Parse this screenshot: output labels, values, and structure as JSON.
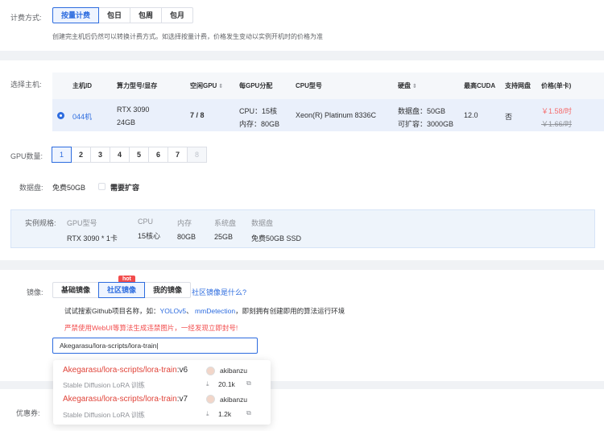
{
  "billing": {
    "label": "计费方式:",
    "options": [
      "按量计费",
      "包日",
      "包周",
      "包月"
    ],
    "hint": "创建完主机后仍然可以转换计费方式。如选择按量计费，价格发生变动以实例开机时的价格为准"
  },
  "host": {
    "label": "选择主机:",
    "headers": [
      "主机ID",
      "算力型号/显存",
      "空闲GPU",
      "每GPU分配",
      "CPU型号",
      "硬盘",
      "最高CUDA",
      "支持网盘",
      "价格(单卡)"
    ],
    "row": {
      "id": "044机",
      "gpu_model": "RTX 3090",
      "vram": "24GB",
      "free_gpu": "7 / 8",
      "cpu_alloc": "CPU：15核",
      "mem_alloc": "内存：80GB",
      "cpu_model": "Xeon(R) Platinum 8336C",
      "disk": "数据盘：50GB",
      "disk_ext": "可扩容：3000GB",
      "cuda": "12.0",
      "netdisk": "否",
      "price": "￥1.58/时",
      "old_price": "￥1.66/时"
    }
  },
  "gpu_count": {
    "label": "GPU数量:",
    "options": [
      "1",
      "2",
      "3",
      "4",
      "5",
      "6",
      "7",
      "8"
    ]
  },
  "data_disk": {
    "label": "数据盘:",
    "free": "免费50GB",
    "expand": "需要扩容"
  },
  "spec": {
    "label": "实例规格:",
    "cols": [
      {
        "h": "GPU型号",
        "v": "RTX 3090 * 1卡"
      },
      {
        "h": "CPU",
        "v": "15核心"
      },
      {
        "h": "内存",
        "v": "80GB"
      },
      {
        "h": "系统盘",
        "v": "25GB"
      },
      {
        "h": "数据盘",
        "v": "免费50GB SSD"
      }
    ]
  },
  "image": {
    "label": "镜像:",
    "tabs": [
      "基础镜像",
      "社区镜像",
      "我的镜像"
    ],
    "hot": "hot",
    "what_link": "社区镜像是什么?",
    "tip_prefix": "试试搜索Github项目名称，如：",
    "tip_link1": "YOLOv5",
    "tip_sep": "、",
    "tip_link2": "mmDetection",
    "tip_suffix": "，即刻拥有创建即用的算法运行环境",
    "warning": "严禁使用WebUI等算法生成违禁图片，一经发现立即封号!",
    "search_value": "Akegarasu/lora-scripts/lora-train",
    "results": [
      {
        "name": "Akegarasu/lora-scripts/lora-train",
        "version": ":v6",
        "user": "akibanzu",
        "desc": "Stable Diffusion LoRA 训练",
        "downloads": "20.1k"
      },
      {
        "name": "Akegarasu/lora-scripts/lora-train",
        "version": ":v7",
        "user": "akibanzu",
        "desc": "Stable Diffusion LoRA 训练",
        "downloads": "1.2k"
      }
    ]
  },
  "coupon": {
    "label": "优惠券:"
  }
}
